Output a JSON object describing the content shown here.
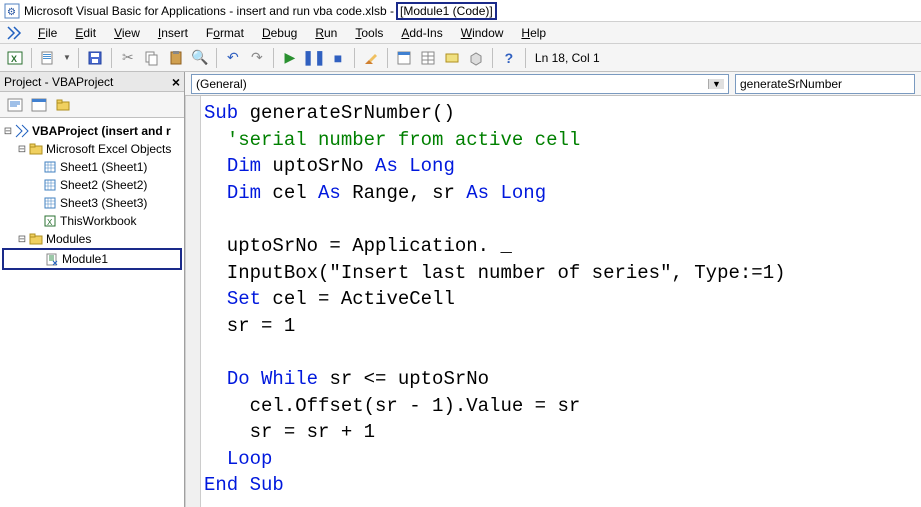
{
  "title": {
    "app": "Microsoft Visual Basic for Applications",
    "file": "insert and run vba code.xlsb",
    "module": "[Module1 (Code)]"
  },
  "menu": {
    "file": "File",
    "edit": "Edit",
    "view": "View",
    "insert": "Insert",
    "format": "Format",
    "debug": "Debug",
    "run": "Run",
    "tools": "Tools",
    "addins": "Add-Ins",
    "window": "Window",
    "help": "Help"
  },
  "toolbar": {
    "status": "Ln 18, Col 1"
  },
  "project": {
    "panelTitle": "Project - VBAProject",
    "root": "VBAProject (insert and r",
    "excelObjects": "Microsoft Excel Objects",
    "sheet1": "Sheet1 (Sheet1)",
    "sheet2": "Sheet2 (Sheet2)",
    "sheet3": "Sheet3 (Sheet3)",
    "thisWorkbook": "ThisWorkbook",
    "modules": "Modules",
    "module1": "Module1"
  },
  "dropdowns": {
    "left": "(General)",
    "right": "generateSrNumber"
  },
  "code": {
    "lines": [
      {
        "t": "kw",
        "pre": "",
        "text": "Sub ",
        "rest": "generateSrNumber()"
      },
      {
        "t": "cm",
        "pre": "  ",
        "text": "'serial number from active cell"
      },
      {
        "t": "mix",
        "pre": "  ",
        "parts": [
          [
            "kw",
            "Dim "
          ],
          [
            "",
            "uptoSrNo "
          ],
          [
            "kw",
            "As Long"
          ]
        ]
      },
      {
        "t": "mix",
        "pre": "  ",
        "parts": [
          [
            "kw",
            "Dim "
          ],
          [
            "",
            "cel "
          ],
          [
            "kw",
            "As "
          ],
          [
            "",
            "Range, sr "
          ],
          [
            "kw",
            "As Long"
          ]
        ]
      },
      {
        "t": "",
        "pre": "",
        "text": ""
      },
      {
        "t": "",
        "pre": "  ",
        "text": "uptoSrNo = Application. _"
      },
      {
        "t": "",
        "pre": "  ",
        "text": "InputBox(\"Insert last number of series\", Type:=1)"
      },
      {
        "t": "mix",
        "pre": "  ",
        "parts": [
          [
            "kw",
            "Set "
          ],
          [
            "",
            "cel = ActiveCell"
          ]
        ]
      },
      {
        "t": "",
        "pre": "  ",
        "text": "sr = 1"
      },
      {
        "t": "",
        "pre": "",
        "text": ""
      },
      {
        "t": "mix",
        "pre": "  ",
        "parts": [
          [
            "kw",
            "Do While "
          ],
          [
            "",
            "sr <= uptoSrNo"
          ]
        ]
      },
      {
        "t": "",
        "pre": "    ",
        "text": "cel.Offset(sr - 1).Value = sr"
      },
      {
        "t": "",
        "pre": "    ",
        "text": "sr = sr + 1"
      },
      {
        "t": "kw",
        "pre": "  ",
        "text": "Loop"
      },
      {
        "t": "kw",
        "pre": "",
        "text": "End Sub"
      }
    ]
  }
}
